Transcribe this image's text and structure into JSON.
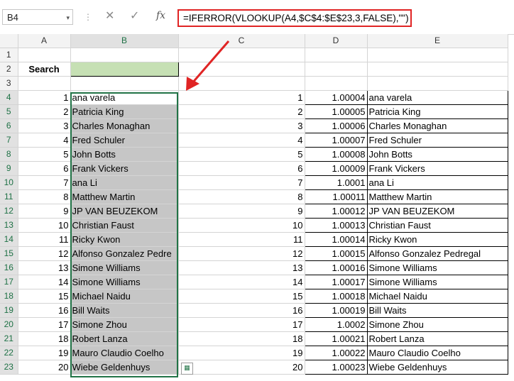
{
  "formula_bar": {
    "name_box": "B4",
    "name_box_dropdown": "▾",
    "cancel": "✕",
    "enter": "✓",
    "fx": "fx",
    "formula": "=IFERROR(VLOOKUP(A4,$C$4:$E$23,3,FALSE),\"\")"
  },
  "columns": [
    "A",
    "B",
    "C",
    "D",
    "E"
  ],
  "search_label": "Search",
  "rows": [
    {
      "r": "1",
      "a": "",
      "b": "",
      "c": "",
      "d": "",
      "e": ""
    },
    {
      "r": "2",
      "a": "",
      "b": "",
      "c": "",
      "d": "",
      "e": ""
    },
    {
      "r": "3",
      "a": "",
      "b": "",
      "c": "",
      "d": "",
      "e": ""
    },
    {
      "r": "4",
      "a": "1",
      "b": "ana varela",
      "c": "1",
      "d": "1.00004",
      "e": "ana varela"
    },
    {
      "r": "5",
      "a": "2",
      "b": "Patricia King",
      "c": "2",
      "d": "1.00005",
      "e": "Patricia King"
    },
    {
      "r": "6",
      "a": "3",
      "b": "Charles Monaghan",
      "c": "3",
      "d": "1.00006",
      "e": "Charles Monaghan"
    },
    {
      "r": "7",
      "a": "4",
      "b": "Fred Schuler",
      "c": "4",
      "d": "1.00007",
      "e": "Fred Schuler"
    },
    {
      "r": "8",
      "a": "5",
      "b": "John Botts",
      "c": "5",
      "d": "1.00008",
      "e": "John Botts"
    },
    {
      "r": "9",
      "a": "6",
      "b": "Frank Vickers",
      "c": "6",
      "d": "1.00009",
      "e": "Frank Vickers"
    },
    {
      "r": "10",
      "a": "7",
      "b": "ana Li",
      "c": "7",
      "d": "1.0001",
      "e": "ana Li"
    },
    {
      "r": "11",
      "a": "8",
      "b": "Matthew Martin",
      "c": "8",
      "d": "1.00011",
      "e": "Matthew Martin"
    },
    {
      "r": "12",
      "a": "9",
      "b": "JP VAN BEUZEKOM",
      "c": "9",
      "d": "1.00012",
      "e": "JP VAN BEUZEKOM"
    },
    {
      "r": "13",
      "a": "10",
      "b": "Christian Faust",
      "c": "10",
      "d": "1.00013",
      "e": "Christian Faust"
    },
    {
      "r": "14",
      "a": "11",
      "b": "Ricky Kwon",
      "c": "11",
      "d": "1.00014",
      "e": "Ricky Kwon"
    },
    {
      "r": "15",
      "a": "12",
      "b": "Alfonso Gonzalez Pedre",
      "c": "12",
      "d": "1.00015",
      "e": "Alfonso Gonzalez Pedregal"
    },
    {
      "r": "16",
      "a": "13",
      "b": "Simone Williams",
      "c": "13",
      "d": "1.00016",
      "e": "Simone Williams"
    },
    {
      "r": "17",
      "a": "14",
      "b": "Simone Williams",
      "c": "14",
      "d": "1.00017",
      "e": "Simone Williams"
    },
    {
      "r": "18",
      "a": "15",
      "b": "Michael Naidu",
      "c": "15",
      "d": "1.00018",
      "e": "Michael Naidu"
    },
    {
      "r": "19",
      "a": "16",
      "b": "Bill Waits",
      "c": "16",
      "d": "1.00019",
      "e": "Bill Waits"
    },
    {
      "r": "20",
      "a": "17",
      "b": "Simone Zhou",
      "c": "17",
      "d": "1.0002",
      "e": "Simone Zhou"
    },
    {
      "r": "21",
      "a": "18",
      "b": "Robert Lanza",
      "c": "18",
      "d": "1.00021",
      "e": "Robert Lanza"
    },
    {
      "r": "22",
      "a": "19",
      "b": "Mauro Claudio Coelho",
      "c": "19",
      "d": "1.00022",
      "e": "Mauro Claudio Coelho"
    },
    {
      "r": "23",
      "a": "20",
      "b": "Wiebe Geldenhuys",
      "c": "20",
      "d": "1.00023",
      "e": "Wiebe Geldenhuys"
    }
  ],
  "colors": {
    "selection_border": "#217346",
    "search_fill": "#c6e0b4",
    "result_fill": "#c6c6c6",
    "highlight": "#e02424"
  }
}
